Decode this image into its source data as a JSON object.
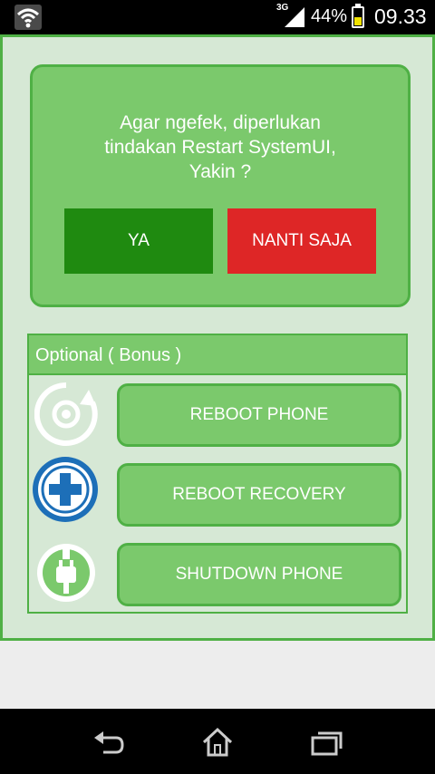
{
  "status_bar": {
    "network": "3G",
    "battery_percent": "44%",
    "battery_level": 0.44,
    "time": "09.33"
  },
  "dialog": {
    "message": "Agar ngefek, diperlukan\ntindakan Restart SystemUI,\nYakin ?",
    "yes_label": "YA",
    "later_label": "NANTI SAJA"
  },
  "bonus": {
    "header": "Optional ( Bonus )",
    "items": [
      {
        "label": "REBOOT PHONE",
        "icon": "reboot-icon"
      },
      {
        "label": "REBOOT RECOVERY",
        "icon": "recovery-icon"
      },
      {
        "label": "SHUTDOWN PHONE",
        "icon": "power-plug-icon"
      }
    ]
  },
  "colors": {
    "accent_green": "#4fb045",
    "panel_green": "#7bc96c",
    "yes_green": "#1f8a10",
    "later_red": "#de2626",
    "recovery_blue": "#1d6fb8"
  },
  "nav": {
    "icons": [
      "back-icon",
      "home-icon",
      "recent-apps-icon"
    ]
  }
}
